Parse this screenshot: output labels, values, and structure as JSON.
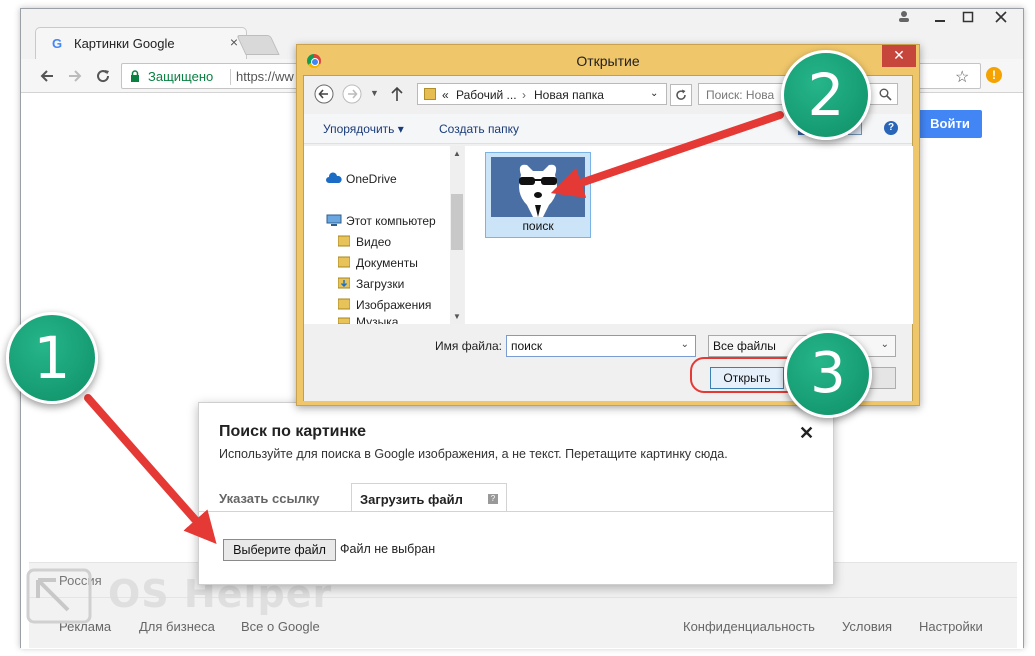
{
  "browser": {
    "tab_title": "Картинки Google",
    "tab_close": "×",
    "security_label": "Защищено",
    "url": "https://ww",
    "signin_label": "Войти"
  },
  "footer": {
    "country": "Россия",
    "links_left": [
      "Реклама",
      "Для бизнеса",
      "Все о Google"
    ],
    "links_right": [
      "Конфиденциальность",
      "Условия",
      "Настройки"
    ]
  },
  "open_dialog": {
    "title": "Открытие",
    "breadcrumb": [
      "«",
      "Рабочий ...",
      "›",
      "Новая папка"
    ],
    "search_placeholder": "Поиск: Нова",
    "organize_label": "Упорядочить ▾",
    "new_folder_label": "Создать папку",
    "nav_items": [
      "OneDrive",
      "Этот компьютер",
      "Видео",
      "Документы",
      "Загрузки",
      "Изображения",
      "Музыка"
    ],
    "file_name": "поиск",
    "file_name_label": "Имя файла:",
    "filter_value": "Все файлы",
    "open_label": "Открыть"
  },
  "upload_dialog": {
    "title": "Поиск по картинке",
    "description": "Используйте для поиска в Google изображения, а не текст. Перетащите картинку сюда.",
    "tab_link": "Указать ссылку",
    "tab_upload": "Загрузить файл",
    "choose_file_label": "Выберите файл",
    "no_file_label": "Файл не выбран",
    "close_label": "✕"
  },
  "annotations": {
    "steps": [
      "1",
      "2",
      "3"
    ],
    "arrow_color": "#e53935",
    "bubble_color": "#17a67a"
  },
  "watermark": {
    "text": "OS Helper"
  },
  "colors": {
    "dialog_frame": "#efc66a",
    "google_blue": "#4285f4",
    "secure_green": "#0b8043"
  }
}
